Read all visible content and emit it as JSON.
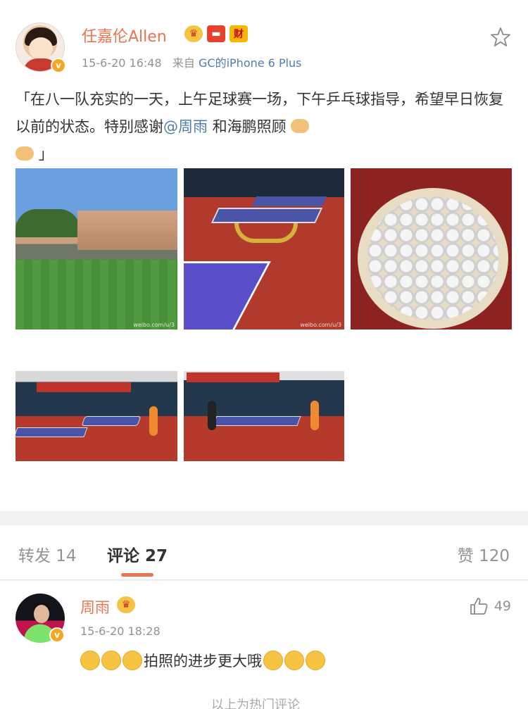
{
  "post": {
    "username": "任嘉伦Allen",
    "timestamp": "15-6-20 16:48",
    "source_prefix": "来自",
    "source": "GC的iPhone 6 Plus",
    "content_part1": "「在八一队充实的一天，上午足球赛一场，下午乒乓球指导，希望早日恢复以前的状态。特别感谢",
    "mention": "@周雨",
    "content_part2": " 和海鹏照顾",
    "content_end": "」",
    "badge_gold_text": "财",
    "verified_mark": "v",
    "photos": [
      {
        "name": "football-field-photo",
        "watermark": "weibo.com/u/3"
      },
      {
        "name": "table-tennis-table-photo",
        "watermark": "weibo.com/u/3"
      },
      {
        "name": "ping-pong-balls-photo",
        "watermark": ""
      },
      {
        "name": "training-hall-photo",
        "watermark": ""
      },
      {
        "name": "players-training-photo",
        "watermark": ""
      }
    ]
  },
  "tabs": {
    "repost": "转发 14",
    "comments": "评论 27",
    "likes": "赞 120"
  },
  "comment": {
    "username": "周雨",
    "timestamp": "15-6-20 18:28",
    "text": "拍照的进步更大哦",
    "likes": "49",
    "verified_mark": "v"
  },
  "footer": {
    "hot_comments_note": "以上为热门评论"
  },
  "colors": {
    "accent": "#eb7350",
    "link": "#507daf",
    "muted": "#939393"
  }
}
